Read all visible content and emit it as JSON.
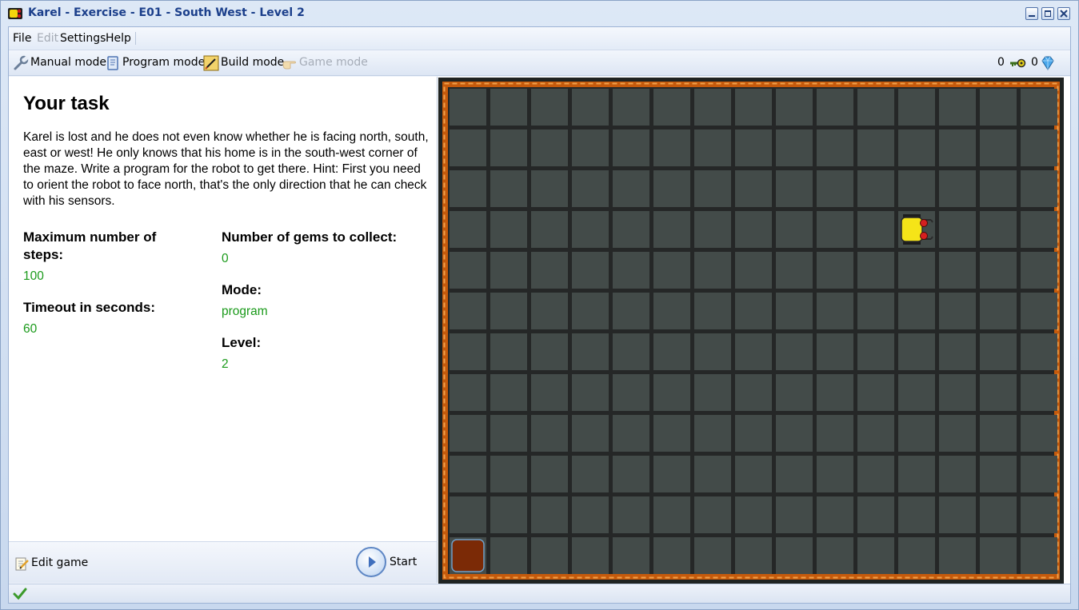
{
  "window": {
    "title": "Karel - Exercise - E01 - South West - Level 2"
  },
  "menu": {
    "file": "File",
    "edit": "Edit",
    "settings": "Settings",
    "help": "Help"
  },
  "toolbar": {
    "manual_mode": "Manual mode",
    "program_mode": "Program mode",
    "build_mode": "Build mode",
    "game_mode": "Game mode",
    "keys_count": "0",
    "gems_count": "0"
  },
  "task": {
    "title": "Your task",
    "description": "Karel is lost and he does not even know whether he is facing north, south, east or west! He only knows that his home is in the south-west corner of the maze. Write a program for the robot to get there. Hint: First you need to orient the robot to face north, that's the only direction that he can check with his sensors.",
    "max_steps_label": "Maximum number of steps:",
    "max_steps_value": "100",
    "timeout_label": "Timeout in seconds:",
    "timeout_value": "60",
    "gems_label": "Number of gems to collect:",
    "gems_value": "0",
    "mode_label": "Mode:",
    "mode_value": "program",
    "level_label": "Level:",
    "level_value": "2"
  },
  "actions": {
    "edit_game": "Edit game",
    "start": "Start"
  },
  "maze": {
    "columns": 15,
    "rows": 12,
    "robot": {
      "column": 12,
      "row": 4,
      "facing": "east"
    },
    "home": {
      "column": 1,
      "row": 12
    },
    "colors": {
      "wall": "#c55a0c",
      "floor": "#434b49",
      "grid": "#252727",
      "home": "#7b2a06",
      "robot": "#f5e418"
    }
  }
}
